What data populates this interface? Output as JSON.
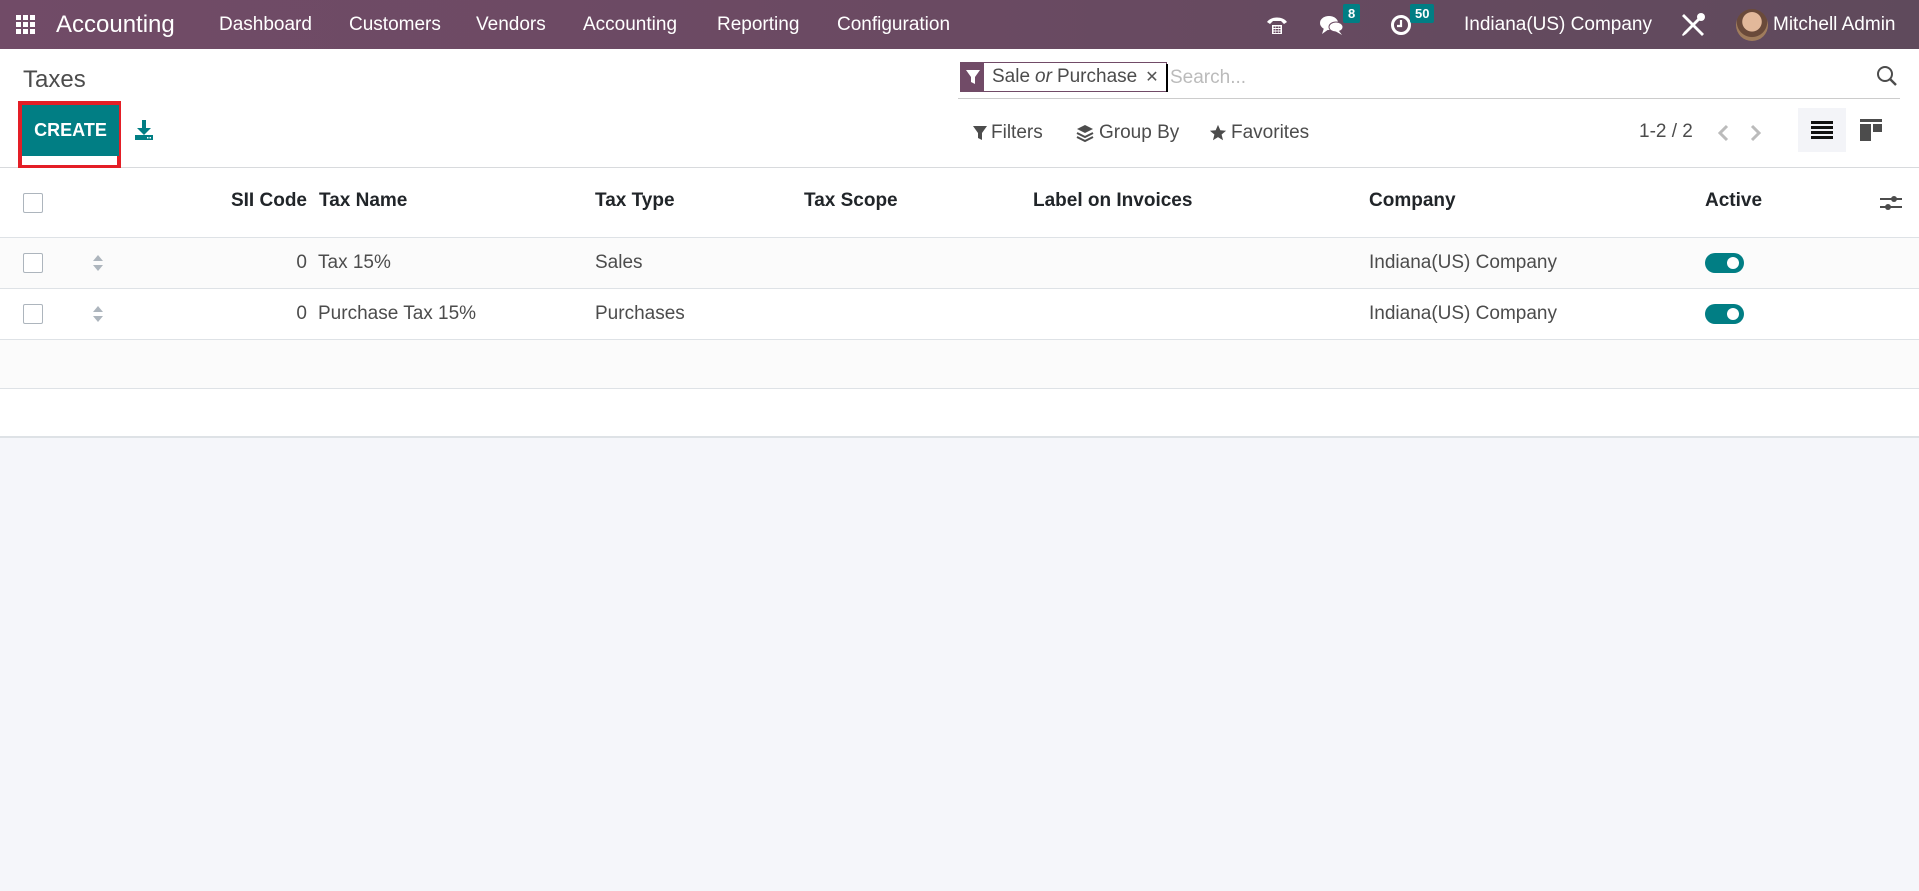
{
  "navbar": {
    "app_name": "Accounting",
    "menu": [
      {
        "label": "Dashboard"
      },
      {
        "label": "Customers"
      },
      {
        "label": "Vendors"
      },
      {
        "label": "Accounting"
      },
      {
        "label": "Reporting"
      },
      {
        "label": "Configuration"
      }
    ],
    "icons": {
      "apps": "apps-grid-icon",
      "phone": "phone-icon",
      "messages": "chat-icon",
      "activities": "clock-icon",
      "debug": "tools-icon"
    },
    "messages_count": "8",
    "activities_count": "50",
    "company": "Indiana(US) Company",
    "user": "Mitchell Admin"
  },
  "control_panel": {
    "title": "Taxes",
    "create_label": "CREATE",
    "search": {
      "facet_values": [
        "Sale",
        "Purchase"
      ],
      "facet_separator": "or",
      "placeholder": "Search..."
    },
    "filters_label": "Filters",
    "group_by_label": "Group By",
    "favorites_label": "Favorites",
    "pager": "1-2 / 2"
  },
  "table": {
    "columns": [
      "SII Code",
      "Tax Name",
      "Tax Type",
      "Tax Scope",
      "Label on Invoices",
      "Company",
      "Active"
    ],
    "rows": [
      {
        "sii_code": "0",
        "tax_name": "Tax 15%",
        "tax_type": "Sales",
        "tax_scope": "",
        "label_on_invoices": "",
        "company": "Indiana(US) Company",
        "active": true
      },
      {
        "sii_code": "0",
        "tax_name": "Purchase Tax 15%",
        "tax_type": "Purchases",
        "tax_scope": "",
        "label_on_invoices": "",
        "company": "Indiana(US) Company",
        "active": true
      }
    ]
  },
  "colors": {
    "brand": "#714B67",
    "primary": "#017e84",
    "highlight": "#e41e26"
  }
}
